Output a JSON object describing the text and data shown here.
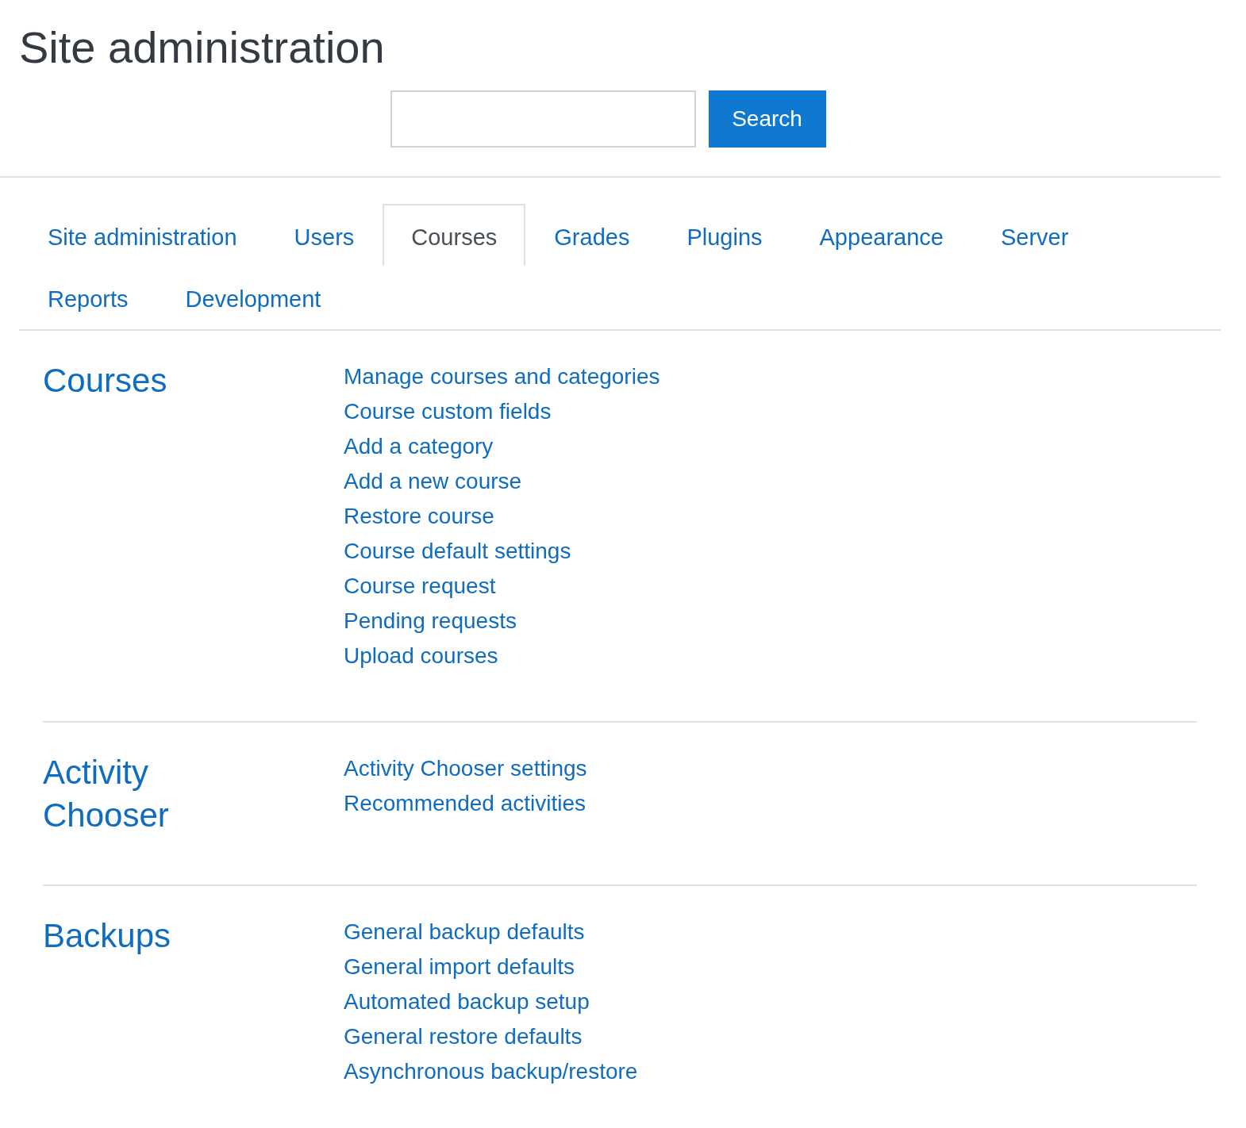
{
  "page_title": "Site administration",
  "search": {
    "button": "Search"
  },
  "tabs": [
    {
      "label": "Site administration",
      "selected": false
    },
    {
      "label": "Users",
      "selected": false
    },
    {
      "label": "Courses",
      "selected": true
    },
    {
      "label": "Grades",
      "selected": false
    },
    {
      "label": "Plugins",
      "selected": false
    },
    {
      "label": "Appearance",
      "selected": false
    },
    {
      "label": "Server",
      "selected": false
    },
    {
      "label": "Reports",
      "selected": false
    },
    {
      "label": "Development",
      "selected": false
    }
  ],
  "sections": [
    {
      "heading": "Courses",
      "links": [
        "Manage courses and categories",
        "Course custom fields",
        "Add a category",
        "Add a new course",
        "Restore course",
        "Course default settings",
        "Course request",
        "Pending requests",
        "Upload courses"
      ]
    },
    {
      "heading": "Activity Chooser",
      "links": [
        "Activity Chooser settings",
        "Recommended activities"
      ]
    },
    {
      "heading": "Backups",
      "links": [
        "General backup defaults",
        "General import defaults",
        "Automated backup setup",
        "General restore defaults",
        "Asynchronous backup/restore"
      ]
    }
  ]
}
